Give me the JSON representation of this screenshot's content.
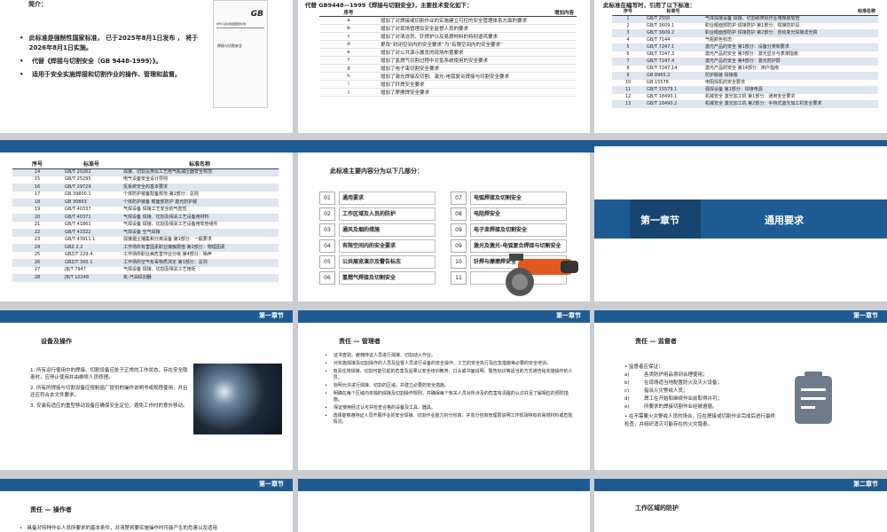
{
  "s1": {
    "heading": "简介：",
    "bullets": [
      "此标准是强制性国家标准， 已于2025年8月1日发布 ， 将于2026年8月1日实施。",
      "代替《焊接与切割安全（GB 9448-1999）》。",
      "适用于安全实施焊接和切割作业的操作、管理和监督。"
    ],
    "doc_logo": "GB",
    "doc_line": "中华人民共和国国家标准",
    "doc_title": "焊接与切割安全"
  },
  "s2": {
    "title": "代替 GB9448—1999《焊接与切割安全》，主要技术变化如下：",
    "col1": "序号",
    "col2": "增加内容",
    "rows": [
      [
        "a",
        "增加了对焊接或切割作业的实施建立可控的安全管理体系方面的要求"
      ],
      [
        "b",
        "增加了对现场管理及安全监督人员的要求"
      ],
      [
        "c",
        "增加了对清洁剂、钎焊护以及易燃材料的特别退风要求"
      ],
      [
        "d",
        "更改“封闭空间内的安全要求”为“有限空间内的安全要求”"
      ],
      [
        "e",
        "增加了对公共演示展览的现场布置要求"
      ],
      [
        "f",
        "增加了氢燃气切割过程中对氢系统使用的安全要求"
      ],
      [
        "g",
        "增加了电子束切割安全要求"
      ],
      [
        "h",
        "增加了激光焊接及切割、激光-电弧复合焊接与切割安全要求"
      ],
      [
        "i",
        "增加了钎焊安全要求"
      ],
      [
        "j",
        "增加了摩擦焊安全要求"
      ]
    ]
  },
  "s3": {
    "title": "此标准在编写时，引用了以下标准：",
    "col1": "序号",
    "col2": "标准号",
    "col3": "标准名称",
    "rows": [
      [
        "1",
        "GB/T 2550",
        "气体焊接设备 焊接、切割和类似作业用橡胶软管"
      ],
      [
        "2",
        "GB/T 3609.1",
        "职业眼面部防护 焊接防护 第1部分：焊接防护具"
      ],
      [
        "3",
        "GB/T 3609.2",
        "职业眼面部防护 焊接防护 第2部分：自动变光焊接滤光镜"
      ],
      [
        "4",
        "GB/T 7144",
        "气瓶颜色标志"
      ],
      [
        "5",
        "GB/T 7247.1",
        "激光产品的安全 第1部分：设备分类和要求"
      ],
      [
        "6",
        "GB/T 7247.3",
        "激光产品的安全 第3部分：激光显示与表演指南"
      ],
      [
        "7",
        "GB/T 7247.4",
        "激光产品的安全 第4部分：激光防护屏"
      ],
      [
        "8",
        "GB/T 7247.14",
        "激光产品的安全 第14部分：用户指南"
      ],
      [
        "9",
        "GB 8965.2",
        "防护服装 焊接服"
      ],
      [
        "10",
        "GB 15578",
        "电阻焊机的安全要求"
      ],
      [
        "11",
        "GB/T 15579.1",
        "弧焊设备 第1部分：焊接电源"
      ],
      [
        "12",
        "GB/T 18490.1",
        "机械安全 激光加工机 第1部分：通用安全要求"
      ],
      [
        "13",
        "GB/T 18490.2",
        "机械安全 激光加工机 第2部分：手持式激光加工机安全要求"
      ]
    ]
  },
  "s4": {
    "col1": "序号",
    "col2": "标准号",
    "col3": "标准名称",
    "rows": [
      [
        "14",
        "GB/T 20262",
        "焊接、切割及类似工艺用气瓶减压器安全规范"
      ],
      [
        "15",
        "GB/T 25295",
        "电气设备安全设计导则"
      ],
      [
        "16",
        "GB/T 29729",
        "氢系统安全的基本要求"
      ],
      [
        "17",
        "GB 39800.1",
        "个体防护装备配备规范 第1部分：总则"
      ],
      [
        "18",
        "GB 30863",
        "个体防护装备 眼面部防护 激光防护镜"
      ],
      [
        "19",
        "GB/T 40337",
        "气焊设备 焊接工艺安全的气密性"
      ],
      [
        "20",
        "GB/T 40371",
        "气焊设备 焊接、切割及相关工艺设备用材料"
      ],
      [
        "21",
        "GB/T 41861",
        "气焊设备 焊接、切割及相关工艺设备用软管组件"
      ],
      [
        "22",
        "GB/T 43322",
        "气焊设备 空气焊接"
      ],
      [
        "23",
        "GB/T 43911.1",
        "焊接烟尘捕集和分离设备 第1部分：一般要求"
      ],
      [
        "24",
        "GBZ 2.2",
        "工作场所有害因素职业接触限值 第2部分：物理因素"
      ],
      [
        "25",
        "GBZ/T 229.4",
        "工作场所职业病危害作业分级 第4部分：噪声"
      ],
      [
        "26",
        "GBZ/T 300.1",
        "工作场所空气有毒物质测定 第1部分：总则"
      ],
      [
        "27",
        "JB/T 7947",
        "气焊设备 焊接、切割及相关工艺用炬"
      ],
      [
        "28",
        "JB/T 10248",
        "氧-汽油焊割器"
      ]
    ]
  },
  "s5": {
    "title": "此标准主要内容分为以下几部分：",
    "items": [
      [
        "01",
        "通用要求"
      ],
      [
        "02",
        "工作区域及人员的防护"
      ],
      [
        "03",
        "通风及烟的措施"
      ],
      [
        "04",
        "有限空间内的安全要求"
      ],
      [
        "05",
        "公共展览演示及警告标志"
      ],
      [
        "06",
        "氢燃气焊接及切割安全"
      ],
      [
        "07",
        "电弧焊接及切割安全"
      ],
      [
        "08",
        "电阻焊安全"
      ],
      [
        "09",
        "电子束焊接及切割安全"
      ],
      [
        "09",
        "激光及激光-电弧复合焊接与切割安全"
      ],
      [
        "10",
        "钎焊与摩擦焊安全"
      ],
      [
        "11",
        ""
      ]
    ]
  },
  "s6": {
    "chapter": "第一章节",
    "title": "通用要求"
  },
  "s7": {
    "band": "第一章节",
    "title": "设备及操作",
    "items": [
      "1.  所有运行使用中的焊接、切割设备应处于正常的工作状态，存在安全隐患时，应停止使用并由维修人员修理。",
      "2.  所有的焊接与切割设备应按制造厂提供的操作说明书或规程使用，并且还应符合本文件要求。",
      "3.  安装有适应的重型移动设备应确保安全定位，避免工作时的意外移动。"
    ]
  },
  "s8": {
    "band": "第一章节",
    "title": "责任 — 管理者",
    "bullets": [
      "证书查验。雇佣持证人员进行焊接、切割动火作业。",
      "对实施焊接及切割操作的人员及监督人员进行设备的安全操作、工艺的安全执行及应急措施等必要的安全培训。",
      "有责任将焊接、切割可能引起的危害及后果以安全培训教育、口头或书面说明、警告标识等适当的方式通告给实施操作的人员。",
      "标明允许进行焊接、切割的区域，并建立必要的安全措施。",
      "明确在每个区域内单独的焊接及切割操作规则，并确保每个有关人员对所涉及的危害有清醒的认识并且了解相应的预防措施。",
      "保证使用经过认可并检查合格的设备及工具、器具。",
      "选择能够遵持证人员开展作业的安全焊接、切割作业能力的分包商，并向分包商管理层说明工作现场特有的易燃材料或危险情况。"
    ]
  },
  "s9": {
    "band": "第一章节",
    "title": "责任 — 监督者",
    "intro": "监督者应保证：",
    "items": [
      [
        "a)",
        "各类防护用品得到合理使用；"
      ],
      [
        "b)",
        "在现场适当地配置防火及灭火设备；"
      ],
      [
        "c)",
        "指派火灾警戒人员；"
      ],
      [
        "d)",
        "焊工在开始和继续作业前取得许可；"
      ],
      [
        "e)",
        "所要求的焊接切割作业经被遵循。"
      ]
    ],
    "note": "在不需要火灾警戒人员的场合，应在焊接或切割作业完成后进行最终检查，并组织消灭可能存在的火灾隐患。"
  },
  "s10": {
    "band": "第一章节",
    "title": "责任 — 操作者",
    "bullet": "具备对特种作业人员所要求的基本条件，并清楚将要实施操作时可能产生的危害以及适用"
  },
  "s12": {
    "band": "第二章节",
    "title": "工作区域的防护"
  }
}
